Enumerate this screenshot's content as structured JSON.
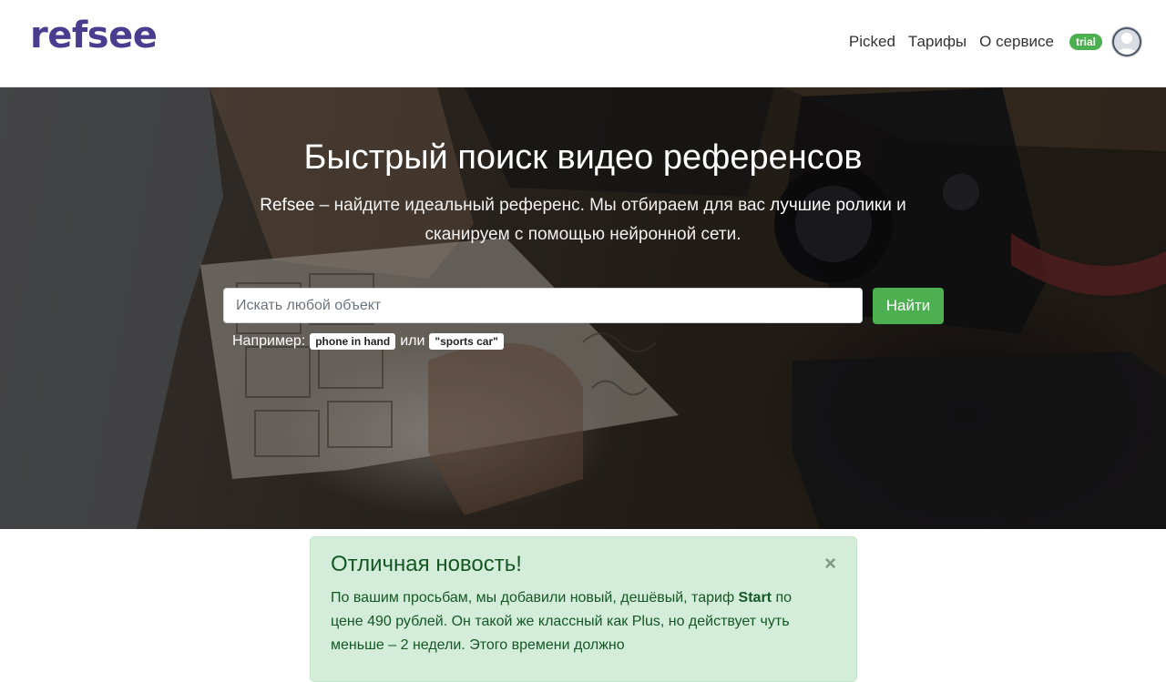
{
  "brand": {
    "logo": "refsee",
    "logo_color": "#4a3d8f"
  },
  "nav": {
    "links": [
      "Picked",
      "Тарифы",
      "О сервисе"
    ],
    "trial_badge": "trial",
    "avatar_icon": "user-avatar-icon"
  },
  "hero": {
    "title": "Быстрый поиск видео референсов",
    "sub_brand": "Refsee",
    "sub_part1": " – найдите идеальный референс. Мы отбираем для вас ",
    "sub_highlight": "лучшие ролики",
    "sub_part2": " и сканируем с помощью нейронной сети.",
    "search_placeholder": "Искать любой объект",
    "search_value": "",
    "search_button": "Найти",
    "examples_label": "Например:",
    "example_1": "phone in hand",
    "examples_or": "или",
    "example_2": "\"sports car\""
  },
  "alert": {
    "title": "Отличная новость!",
    "close": "×",
    "text_1": "По вашим просьбам, мы добавили новый, дешёвый, тариф ",
    "text_bold": "Start",
    "text_2": " по цене 490 рублей. Он такой же классный как Plus, но действует чуть меньше – 2 недели. Этого времени должно"
  },
  "colors": {
    "accent_green": "#4caf50",
    "alert_bg": "#d4edda",
    "alert_text": "#155724"
  }
}
